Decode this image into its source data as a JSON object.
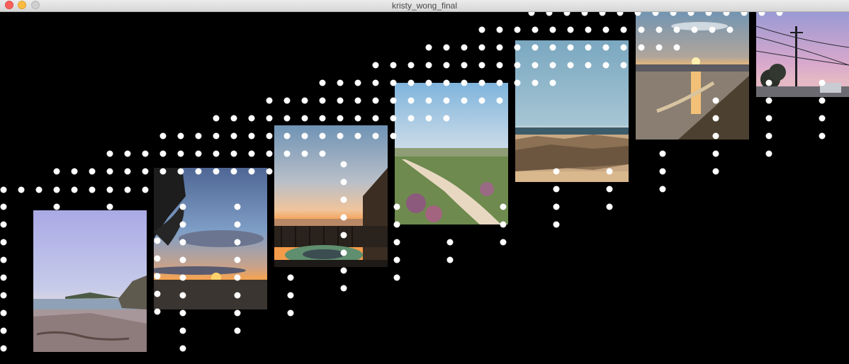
{
  "window": {
    "title": "kristy_wong_final"
  },
  "photos": [
    {
      "name": "photo-beach-cliff",
      "subject": "beach with cliffs at dusk"
    },
    {
      "name": "photo-sunset-tree",
      "subject": "sunset with tree silhouette"
    },
    {
      "name": "photo-sunset-deck",
      "subject": "sunset over ocean from deck with hot tub"
    },
    {
      "name": "photo-coastal-path",
      "subject": "sandy path through coastal ice plant"
    },
    {
      "name": "photo-rocky-shore",
      "subject": "rocky shoreline under blue sky"
    },
    {
      "name": "photo-sunset-reflection",
      "subject": "sunset reflecting on wet sand"
    },
    {
      "name": "photo-power-lines",
      "subject": "power lines against pink sky"
    }
  ],
  "colors": {
    "background": "#000000",
    "dots": "#ffffff"
  }
}
